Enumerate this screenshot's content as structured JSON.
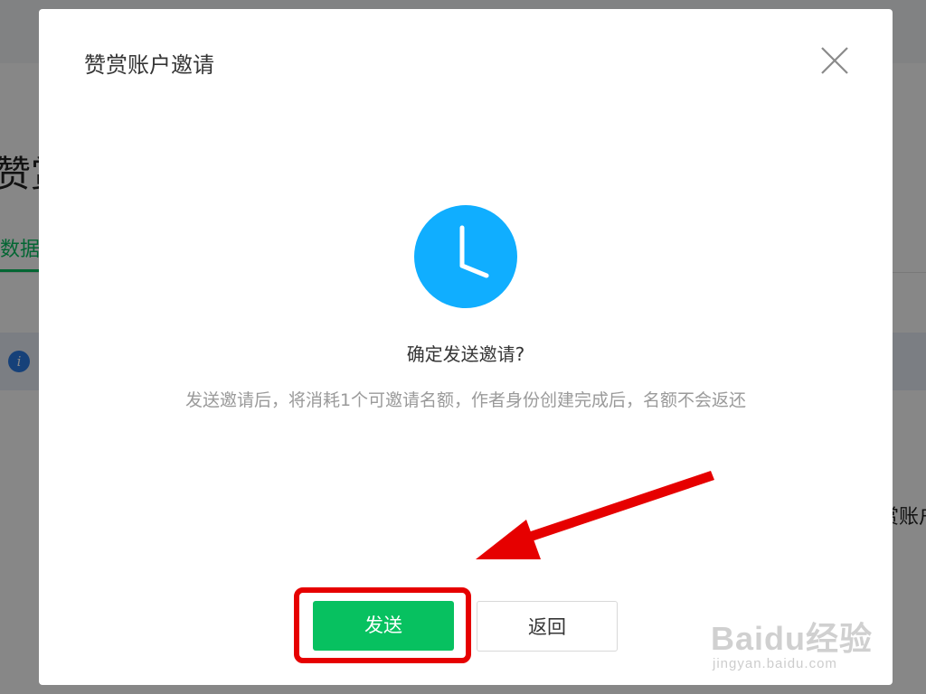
{
  "background": {
    "page_title_partial": "赞赏",
    "tab_label_partial": "数据概",
    "right_text_partial": "赏账户",
    "info_icon": "info-icon"
  },
  "dialog": {
    "title": "赞赏账户邀请",
    "close_icon": "close-icon",
    "status_icon": "clock-icon",
    "confirm_title": "确定发送邀请?",
    "confirm_desc": "发送邀请后，将消耗1个可邀请名额，作者身份创建完成后，名额不会返还",
    "send_label": "发送",
    "back_label": "返回"
  },
  "watermark": {
    "logo": "Baidu经验",
    "url": "jingyan.baidu.com"
  },
  "colors": {
    "accent_green": "#07c160",
    "clock_blue": "#10aeff",
    "annotation_red": "#e60000",
    "overlay": "rgba(0,0,0,0.47)"
  }
}
